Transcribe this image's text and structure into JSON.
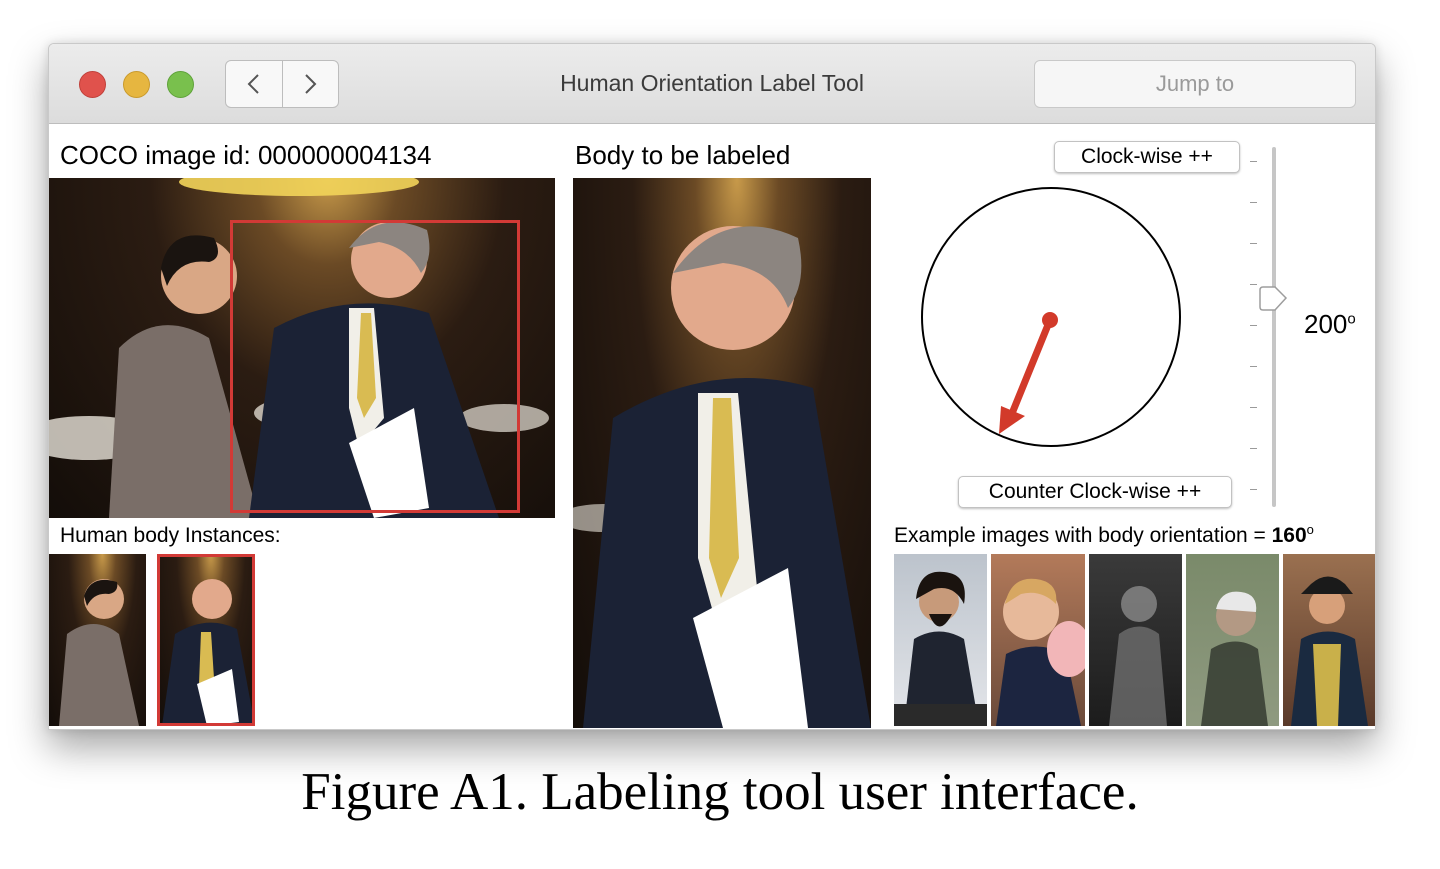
{
  "window": {
    "title": "Human Orientation Label Tool",
    "jump_label": "Jump to",
    "nav_back_icon": "chevron-left-icon",
    "nav_forward_icon": "chevron-right-icon"
  },
  "left_panel": {
    "image_id_label": "COCO image id: 000000004134",
    "instances_label": "Human body Instances:",
    "instance_count": 2,
    "selected_instance": 2
  },
  "center_panel": {
    "title": "Body to be labeled"
  },
  "controls": {
    "clockwise_label": "Clock-wise ++",
    "counter_clockwise_label": "Counter Clock-wise ++",
    "angle_value": "200",
    "angle_unit": "o",
    "slider_value_deg": 200,
    "arrow_color": "#d23a2a"
  },
  "examples": {
    "label_prefix": "Example images with body orientation = ",
    "orientation_value": "160",
    "orientation_unit": "o",
    "count": 5
  },
  "caption": "Figure A1. Labeling tool user interface.",
  "colors": {
    "selection_red": "#d23a36",
    "traffic_red": "#e0524c",
    "traffic_yellow": "#e6b640",
    "traffic_green": "#79c04d"
  }
}
